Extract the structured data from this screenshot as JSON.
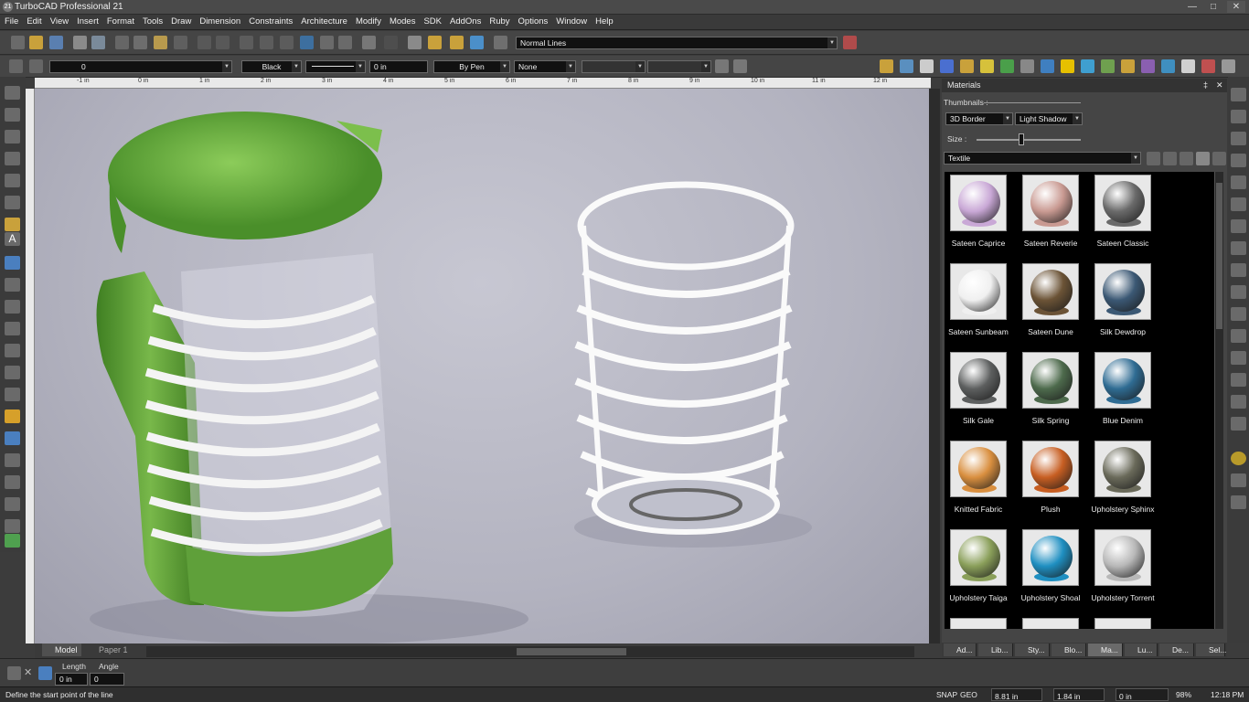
{
  "window": {
    "title": "TurboCAD Professional 21",
    "logo": "21",
    "minimize": "—",
    "maximize": "□",
    "close": "✕"
  },
  "menu": [
    "File",
    "Edit",
    "View",
    "Insert",
    "Format",
    "Tools",
    "Draw",
    "Dimension",
    "Constraints",
    "Architecture",
    "Modify",
    "Modes",
    "SDK",
    "AddOns",
    "Ruby",
    "Options",
    "Window",
    "Help"
  ],
  "toolbar1": {
    "line_style": "Normal Lines"
  },
  "toolbar2": {
    "layer": "0",
    "color": "Black",
    "width": "0 in",
    "pen": "By Pen",
    "fill": "None"
  },
  "ruler": {
    "marks": [
      "-1 in",
      "0 in",
      "1 in",
      "2 in",
      "3 in",
      "4 in",
      "5 in",
      "6 in",
      "7 in",
      "8 in",
      "9 in",
      "10 in",
      "11 in",
      "12 in"
    ]
  },
  "view_tabs": {
    "model": "Model",
    "paper": "Paper 1"
  },
  "materials": {
    "title": "Materials",
    "pin": "‡",
    "close": "✕",
    "thumbnails_label": "Thumbnails :",
    "border_style": "3D Border",
    "shadow_style": "Light Shadow",
    "size_label": "Size :",
    "category": "Textile",
    "items": [
      {
        "name": "Sateen Caprice",
        "color": "#c9a8d6"
      },
      {
        "name": "Sateen Reverie",
        "color": "#c99a92"
      },
      {
        "name": "Sateen Classic",
        "color": "#6a6a6a"
      },
      {
        "name": "Sateen Sunbeam",
        "color": "#f0f0f0"
      },
      {
        "name": "Sateen Dune",
        "color": "#6b5336"
      },
      {
        "name": "Silk Dewdrop",
        "color": "#3b5874"
      },
      {
        "name": "Silk Gale",
        "color": "#5d5f5f"
      },
      {
        "name": "Silk Spring",
        "color": "#4d6a4c"
      },
      {
        "name": "Blue Denim",
        "color": "#2f6c93"
      },
      {
        "name": "Knitted Fabric",
        "color": "#d98f3f"
      },
      {
        "name": "Plush",
        "color": "#c75e22"
      },
      {
        "name": "Upholstery Sphinx",
        "color": "#6a6a5a"
      },
      {
        "name": "Upholstery Taiga",
        "color": "#8a9f5a"
      },
      {
        "name": "Upholstery Shoal",
        "color": "#1f8fc1"
      },
      {
        "name": "Upholstery Torrent",
        "color": "#b8b8b8"
      }
    ],
    "tabs": [
      "Ad...",
      "Lib...",
      "Sty...",
      "Blo...",
      "Ma...",
      "Lu...",
      "De...",
      "Sel..."
    ]
  },
  "inputbar": {
    "length_label": "Length",
    "angle_label": "Angle",
    "length_value": "0 in",
    "angle_value": "0"
  },
  "status": {
    "prompt": "Define the start point of the line",
    "snap": "SNAP",
    "geo": "GEO",
    "x": "8.81 in",
    "y": "1.84 in",
    "z": "0 in",
    "zoom": "98%",
    "time": "12:18 PM"
  }
}
